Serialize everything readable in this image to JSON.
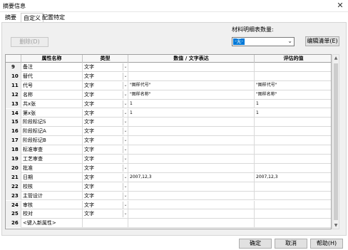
{
  "window": {
    "title": "摘要信息",
    "close_glyph": "✕"
  },
  "tabs": [
    {
      "label": "摘要"
    },
    {
      "label": "自定义"
    },
    {
      "label": "配置特定"
    }
  ],
  "toolbar": {
    "delete_label": "删除(D)",
    "edit_list_label": "编辑清单(E)"
  },
  "bom": {
    "label": "材料明细表数量:",
    "selected": "-无-"
  },
  "table": {
    "headers": [
      "",
      "属性名称",
      "类型",
      "数值 / 文字表达",
      "评估的值"
    ],
    "rows": [
      {
        "num": "9",
        "name": "备注",
        "type": "文字",
        "value": "",
        "evaluated": ""
      },
      {
        "num": "10",
        "name": "替代",
        "type": "文字",
        "value": "",
        "evaluated": ""
      },
      {
        "num": "11",
        "name": "代号",
        "type": "文字",
        "value": "\"图样代号\"",
        "evaluated": "\"图样代号\""
      },
      {
        "num": "12",
        "name": "名称",
        "type": "文字",
        "value": "\"图样名称\"",
        "evaluated": "\"图样名称\""
      },
      {
        "num": "13",
        "name": "共x张",
        "type": "文字",
        "value": "1",
        "evaluated": "1"
      },
      {
        "num": "14",
        "name": "第x张",
        "type": "文字",
        "value": "1",
        "evaluated": "1"
      },
      {
        "num": "15",
        "name": "阶段标记S",
        "type": "文字",
        "value": "",
        "evaluated": ""
      },
      {
        "num": "16",
        "name": "阶段标记A",
        "type": "文字",
        "value": "",
        "evaluated": ""
      },
      {
        "num": "17",
        "name": "阶段标记B",
        "type": "文字",
        "value": "",
        "evaluated": ""
      },
      {
        "num": "18",
        "name": "标准审查",
        "type": "文字",
        "value": "",
        "evaluated": ""
      },
      {
        "num": "19",
        "name": "工艺审查",
        "type": "文字",
        "value": "",
        "evaluated": ""
      },
      {
        "num": "20",
        "name": "批准",
        "type": "文字",
        "value": "",
        "evaluated": ""
      },
      {
        "num": "21",
        "name": "日期",
        "type": "文字",
        "value": "2007,12,3",
        "evaluated": "2007,12,3"
      },
      {
        "num": "22",
        "name": "校核",
        "type": "文字",
        "value": "",
        "evaluated": ""
      },
      {
        "num": "23",
        "name": "主管设计",
        "type": "文字",
        "value": "",
        "evaluated": ""
      },
      {
        "num": "24",
        "name": "审核",
        "type": "文字",
        "value": "",
        "evaluated": ""
      },
      {
        "num": "25",
        "name": "校对",
        "type": "文字",
        "value": "",
        "evaluated": ""
      },
      {
        "num": "26",
        "name": "<键入新属性>",
        "type": "",
        "value": "",
        "evaluated": ""
      }
    ]
  },
  "buttons": {
    "ok": "确定",
    "cancel": "取消",
    "help": "帮助(H)"
  }
}
